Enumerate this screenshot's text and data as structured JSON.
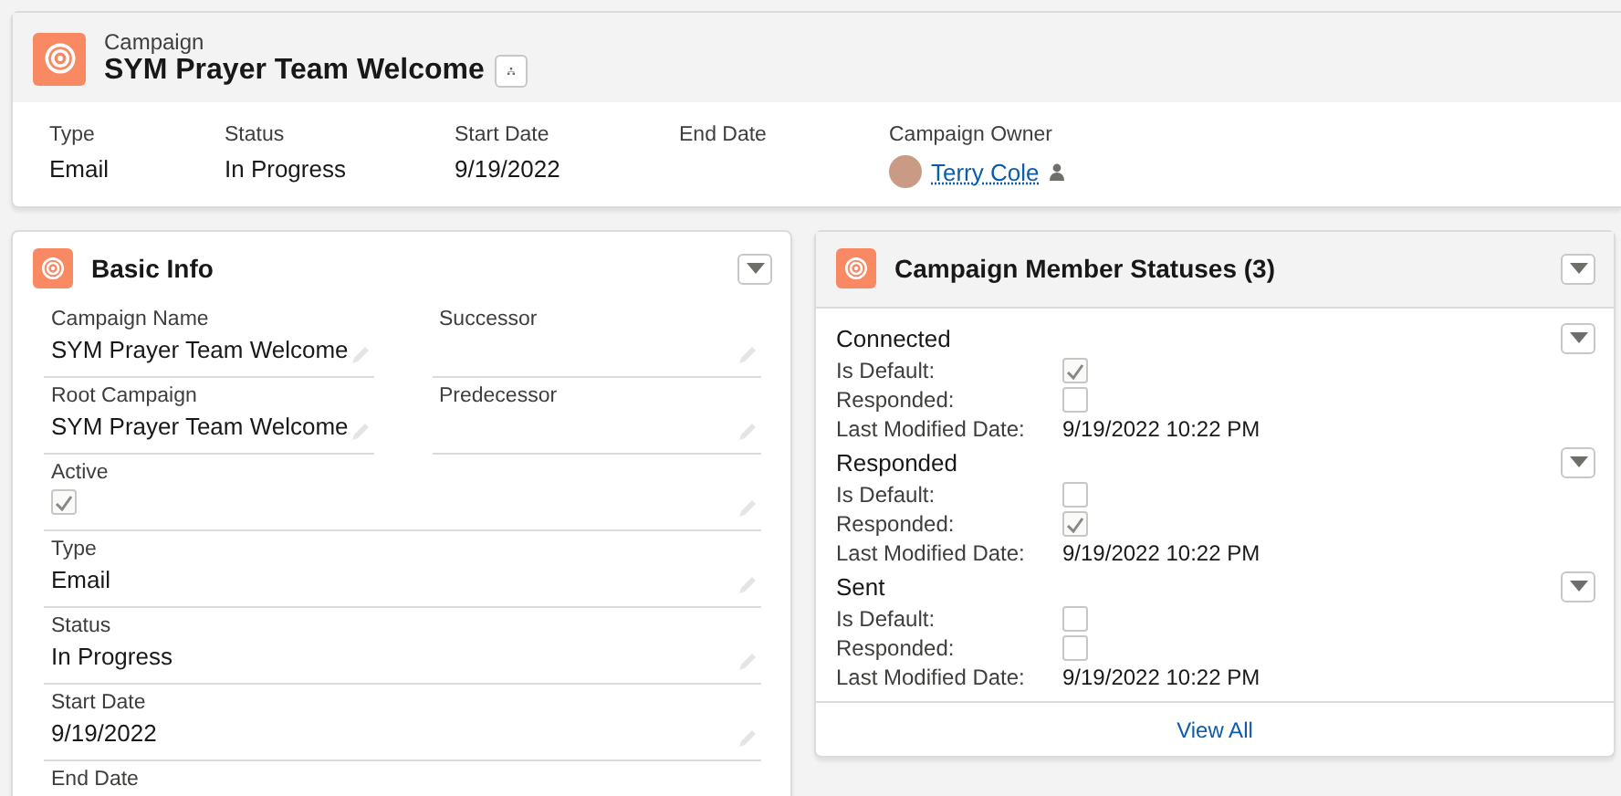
{
  "header": {
    "object_type": "Campaign",
    "title": "SYM Prayer Team Welcome",
    "fields": [
      {
        "label": "Type",
        "value": "Email"
      },
      {
        "label": "Status",
        "value": "In Progress"
      },
      {
        "label": "Start Date",
        "value": "9/19/2022"
      },
      {
        "label": "End Date"
      }
    ],
    "owner": {
      "label": "Campaign Owner",
      "name": "Terry Cole"
    }
  },
  "basic_info": {
    "title": "Basic Info",
    "rows": [
      [
        {
          "label": "Campaign Name",
          "kind": "text",
          "value": "SYM Prayer Team Welcome"
        },
        {
          "label": "Successor",
          "kind": "text"
        }
      ],
      [
        {
          "label": "Root Campaign",
          "kind": "text",
          "value": "SYM Prayer Team Welcome"
        },
        {
          "label": "Predecessor",
          "kind": "text"
        }
      ],
      [
        {
          "label": "Active",
          "kind": "checkbox",
          "checked": true
        }
      ],
      [
        {
          "label": "Type",
          "kind": "text",
          "value": "Email"
        }
      ],
      [
        {
          "label": "Status",
          "kind": "text",
          "value": "In Progress"
        }
      ],
      [
        {
          "label": "Start Date",
          "kind": "text",
          "value": "9/19/2022"
        }
      ],
      [
        {
          "label": "End Date",
          "kind": "text"
        }
      ]
    ]
  },
  "member_statuses": {
    "title": "Campaign Member Statuses (3)",
    "items": [
      {
        "name": "Connected",
        "is_default_label": "Is Default:",
        "is_default": true,
        "responded_label": "Responded:",
        "responded": false,
        "date_label": "Last Modified Date:",
        "date": "9/19/2022 10:22 PM"
      },
      {
        "name": "Responded",
        "is_default_label": "Is Default:",
        "is_default": false,
        "responded_label": "Responded:",
        "responded": true,
        "date_label": "Last Modified Date:",
        "date": "9/19/2022 10:22 PM"
      },
      {
        "name": "Sent",
        "is_default_label": "Is Default:",
        "is_default": false,
        "responded_label": "Responded:",
        "responded": false,
        "date_label": "Last Modified Date:",
        "date": "9/19/2022 10:22 PM"
      }
    ],
    "footer_link": "View All"
  }
}
